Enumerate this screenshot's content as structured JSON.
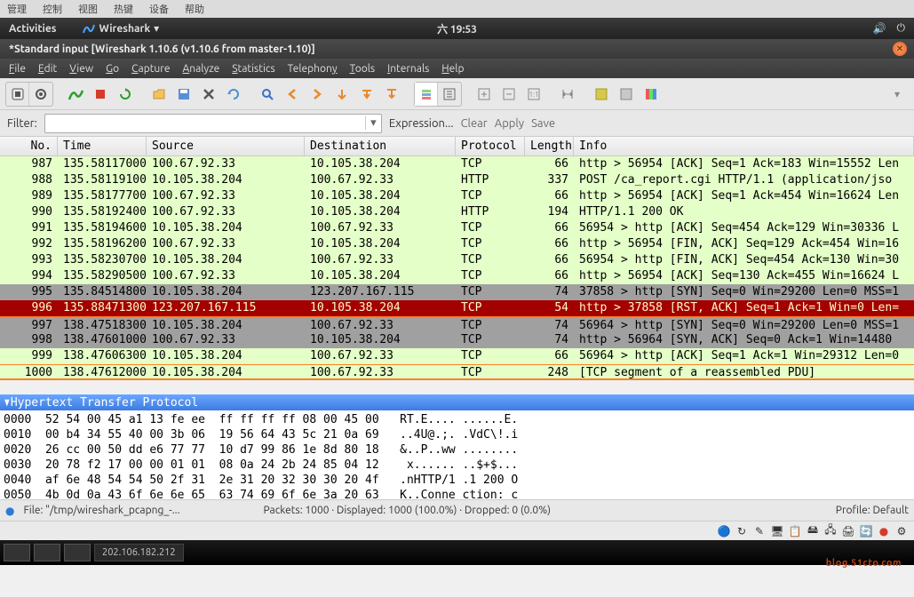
{
  "os_menu": [
    "管理",
    "控制",
    "视图",
    "热键",
    "设备",
    "帮助"
  ],
  "topbar": {
    "activities": "Activities",
    "app": "Wireshark",
    "clock": "六 19:53"
  },
  "window_title": "*Standard input   [Wireshark 1.10.6  (v1.10.6 from master-1.10)]",
  "menus": [
    {
      "u": "F",
      "rest": "ile"
    },
    {
      "u": "E",
      "rest": "dit"
    },
    {
      "u": "V",
      "rest": "iew"
    },
    {
      "u": "G",
      "rest": "o"
    },
    {
      "u": "C",
      "rest": "apture"
    },
    {
      "u": "A",
      "rest": "nalyze"
    },
    {
      "u": "S",
      "rest": "tatistics"
    },
    {
      "pre": "Telephon",
      "u": "y",
      "rest": ""
    },
    {
      "u": "T",
      "rest": "ools"
    },
    {
      "u": "I",
      "rest": "nternals"
    },
    {
      "u": "H",
      "rest": "elp"
    }
  ],
  "filter": {
    "label": "Filter:",
    "value": "",
    "expression": "Expression...",
    "clear": "Clear",
    "apply": "Apply",
    "save": "Save"
  },
  "columns": {
    "no": "No.",
    "time": "Time",
    "src": "Source",
    "dst": "Destination",
    "proto": "Protocol",
    "len": "Length",
    "info": "Info"
  },
  "packets": [
    {
      "no": "987",
      "time": "135.58117000",
      "src": "100.67.92.33",
      "dst": "10.105.38.204",
      "proto": "TCP",
      "len": "66",
      "info": "http > 56954 [ACK] Seq=1 Ack=183 Win=15552 Len",
      "cls": "tcp"
    },
    {
      "no": "988",
      "time": "135.58119100",
      "src": "10.105.38.204",
      "dst": "100.67.92.33",
      "proto": "HTTP",
      "len": "337",
      "info": "POST /ca_report.cgi HTTP/1.1  (application/jso",
      "cls": "http"
    },
    {
      "no": "989",
      "time": "135.58177700",
      "src": "100.67.92.33",
      "dst": "10.105.38.204",
      "proto": "TCP",
      "len": "66",
      "info": "http > 56954 [ACK] Seq=1 Ack=454 Win=16624 Len",
      "cls": "tcp"
    },
    {
      "no": "990",
      "time": "135.58192400",
      "src": "100.67.92.33",
      "dst": "10.105.38.204",
      "proto": "HTTP",
      "len": "194",
      "info": "HTTP/1.1 200 OK",
      "cls": "http"
    },
    {
      "no": "991",
      "time": "135.58194600",
      "src": "10.105.38.204",
      "dst": "100.67.92.33",
      "proto": "TCP",
      "len": "66",
      "info": "56954 > http [ACK] Seq=454 Ack=129 Win=30336 L",
      "cls": "tcp"
    },
    {
      "no": "992",
      "time": "135.58196200",
      "src": "100.67.92.33",
      "dst": "10.105.38.204",
      "proto": "TCP",
      "len": "66",
      "info": "http > 56954 [FIN, ACK] Seq=129 Ack=454 Win=16",
      "cls": "tcp"
    },
    {
      "no": "993",
      "time": "135.58230700",
      "src": "10.105.38.204",
      "dst": "100.67.92.33",
      "proto": "TCP",
      "len": "66",
      "info": "56954 > http [FIN, ACK] Seq=454 Ack=130 Win=30",
      "cls": "tcp"
    },
    {
      "no": "994",
      "time": "135.58290500",
      "src": "100.67.92.33",
      "dst": "10.105.38.204",
      "proto": "TCP",
      "len": "66",
      "info": "http > 56954 [ACK] Seq=130 Ack=455 Win=16624 L",
      "cls": "tcp"
    },
    {
      "no": "995",
      "time": "135.84514800",
      "src": "10.105.38.204",
      "dst": "123.207.167.115",
      "proto": "TCP",
      "len": "74",
      "info": "37858 > http [SYN] Seq=0 Win=29200 Len=0 MSS=1",
      "cls": "syn"
    },
    {
      "no": "996",
      "time": "135.88471300",
      "src": "123.207.167.115",
      "dst": "10.105.38.204",
      "proto": "TCP",
      "len": "54",
      "info": "http > 37858 [RST, ACK] Seq=1 Ack=1 Win=0 Len=",
      "cls": "rst"
    },
    {
      "no": "997",
      "time": "138.47518300",
      "src": "10.105.38.204",
      "dst": "100.67.92.33",
      "proto": "TCP",
      "len": "74",
      "info": "56964 > http [SYN] Seq=0 Win=29200 Len=0 MSS=1",
      "cls": "syn sel-border-top"
    },
    {
      "no": "998",
      "time": "138.47601000",
      "src": "100.67.92.33",
      "dst": "10.105.38.204",
      "proto": "TCP",
      "len": "74",
      "info": "http > 56964 [SYN, ACK] Seq=0 Ack=1 Win=14480 ",
      "cls": "syn"
    },
    {
      "no": "999",
      "time": "138.47606300",
      "src": "10.105.38.204",
      "dst": "100.67.92.33",
      "proto": "TCP",
      "len": "66",
      "info": "56964 > http [ACK] Seq=1 Ack=1 Win=29312 Len=0",
      "cls": "tcp"
    },
    {
      "no": "1000",
      "time": "138.47612000",
      "src": "10.105.38.204",
      "dst": "100.67.92.33",
      "proto": "TCP",
      "len": "248",
      "info": "[TCP segment of a reassembled PDU]",
      "cls": "tcp last-border"
    }
  ],
  "detail_header": "Hypertext Transfer Protocol",
  "hex": [
    "0000  52 54 00 45 a1 13 fe ee  ff ff ff ff 08 00 45 00   RT.E.... ......E.",
    "0010  00 b4 34 55 40 00 3b 06  19 56 64 43 5c 21 0a 69   ..4U@.;. .VdC\\!.i",
    "0020  26 cc 00 50 dd e6 77 77  10 d7 99 86 1e 8d 80 18   &..P..ww ........",
    "0030  20 78 f2 17 00 00 01 01  08 0a 24 2b 24 85 04 12    x...... ..$+$...",
    "0040  af 6e 48 54 54 50 2f 31  2e 31 20 32 30 30 20 4f   .nHTTP/1 .1 200 O",
    "0050  4b 0d 0a 43 6f 6e 6e 65  63 74 69 6f 6e 3a 20 63   K..Conne ction: c"
  ],
  "status": {
    "file": "File: \"/tmp/wireshark_pcapng_-...",
    "packets": "Packets: 1000 · Displayed: 1000 (100.0%) · Dropped: 0 (0.0%)",
    "profile": "Profile: Default"
  },
  "taskbar_ip": "202.106.182.212",
  "watermark": "blog.51cto.com"
}
